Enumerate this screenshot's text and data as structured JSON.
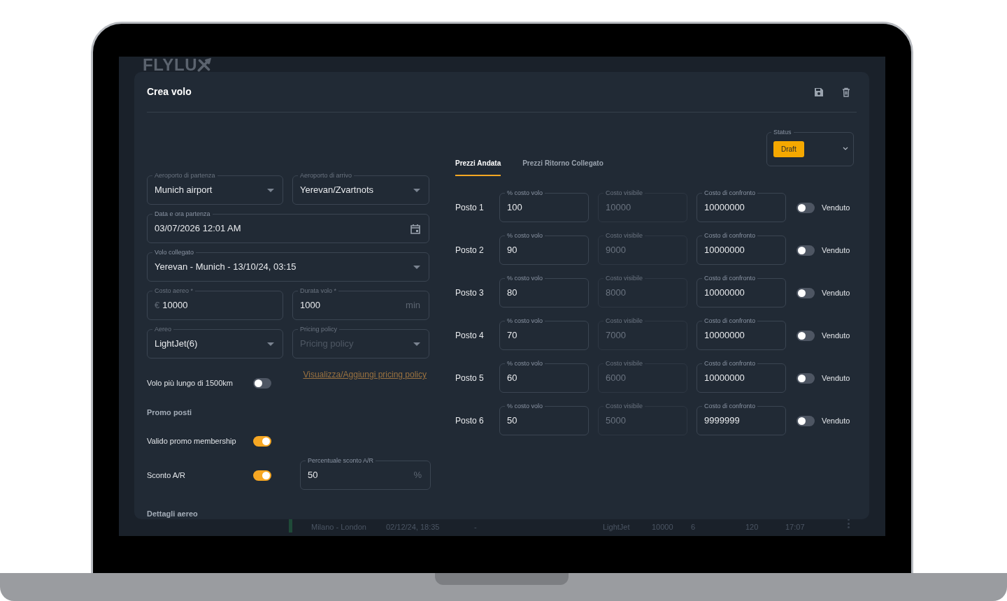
{
  "logo": {
    "text": "FLYLU"
  },
  "dialog": {
    "title": "Crea volo"
  },
  "form_rows": [
    [
      {
        "kind": "select",
        "label": "Aeroporto di partenza",
        "value": "Munich airport"
      },
      {
        "kind": "select",
        "label": "Aeroporto di arrivo",
        "value": "Yerevan/Zvartnots"
      }
    ],
    [
      {
        "kind": "date",
        "label": "Data e ora partenza",
        "value": "03/07/2026 12:01 AM"
      }
    ],
    [
      {
        "kind": "select",
        "label": "Volo collegato",
        "value": "Yerevan - Munich - 13/10/24, 03:15"
      }
    ],
    [
      {
        "kind": "text",
        "label": "Costo aereo *",
        "value": "10000",
        "prefix": "€"
      },
      {
        "kind": "text",
        "label": "Durata volo *",
        "value": "1000",
        "suffix": "min"
      }
    ],
    [
      {
        "kind": "select",
        "label": "Aereo",
        "value": "LightJet(6)"
      },
      {
        "kind": "select",
        "label": "Pricing policy",
        "placeholder": "Pricing policy"
      }
    ]
  ],
  "pricing_link": "Visualizza/Aggiungi pricing policy",
  "options": [
    {
      "kind": "toggle",
      "label": "Volo più lungo di 1500km",
      "on": false
    },
    {
      "kind": "heading",
      "label": "Promo posti"
    },
    {
      "kind": "toggle",
      "label": "Valido promo membership",
      "on": true
    },
    {
      "kind": "toggle",
      "label": "Sconto A/R",
      "on": true,
      "field": {
        "label": "Percentuale sconto A/R",
        "value": "50",
        "suffix": "%"
      }
    }
  ],
  "section_heading": "Dettagli aereo",
  "status": {
    "label": "Status",
    "value": "Draft"
  },
  "tabs": [
    {
      "label": "Prezzi Andata",
      "selected": true
    },
    {
      "label": "Prezzi Ritorno Collegato",
      "selected": false
    }
  ],
  "seats": [
    {
      "label": "Posto 1",
      "fields": [
        {
          "label": "% costo volo",
          "value": "100",
          "disabled": false
        },
        {
          "label": "Costo visibile",
          "value": "10000",
          "disabled": true
        },
        {
          "label": "Costo di confronto",
          "value": "10000000",
          "disabled": false
        }
      ],
      "sold_label": "Venduto",
      "sold": false
    },
    {
      "label": "Posto 2",
      "fields": [
        {
          "label": "% costo volo",
          "value": "90",
          "disabled": false
        },
        {
          "label": "Costo visibile",
          "value": "9000",
          "disabled": true
        },
        {
          "label": "Costo di confronto",
          "value": "10000000",
          "disabled": false
        }
      ],
      "sold_label": "Venduto",
      "sold": false
    },
    {
      "label": "Posto 3",
      "fields": [
        {
          "label": "% costo volo",
          "value": "80",
          "disabled": false
        },
        {
          "label": "Costo visibile",
          "value": "8000",
          "disabled": true
        },
        {
          "label": "Costo di confronto",
          "value": "10000000",
          "disabled": false
        }
      ],
      "sold_label": "Venduto",
      "sold": false
    },
    {
      "label": "Posto 4",
      "fields": [
        {
          "label": "% costo volo",
          "value": "70",
          "disabled": false
        },
        {
          "label": "Costo visibile",
          "value": "7000",
          "disabled": true
        },
        {
          "label": "Costo di confronto",
          "value": "10000000",
          "disabled": false
        }
      ],
      "sold_label": "Venduto",
      "sold": false
    },
    {
      "label": "Posto 5",
      "fields": [
        {
          "label": "% costo volo",
          "value": "60",
          "disabled": false
        },
        {
          "label": "Costo visibile",
          "value": "6000",
          "disabled": true
        },
        {
          "label": "Costo di confronto",
          "value": "10000000",
          "disabled": false
        }
      ],
      "sold_label": "Venduto",
      "sold": false
    },
    {
      "label": "Posto 6",
      "fields": [
        {
          "label": "% costo volo",
          "value": "50",
          "disabled": false
        },
        {
          "label": "Costo visibile",
          "value": "5000",
          "disabled": true
        },
        {
          "label": "Costo di confronto",
          "value": "9999999",
          "disabled": false
        }
      ],
      "sold_label": "Venduto",
      "sold": false
    }
  ],
  "background_row": {
    "cells": [
      "Milano - London",
      "02/12/24, 18:35",
      "-",
      "LightJet",
      "10000",
      "6",
      "120",
      "17:07"
    ]
  }
}
